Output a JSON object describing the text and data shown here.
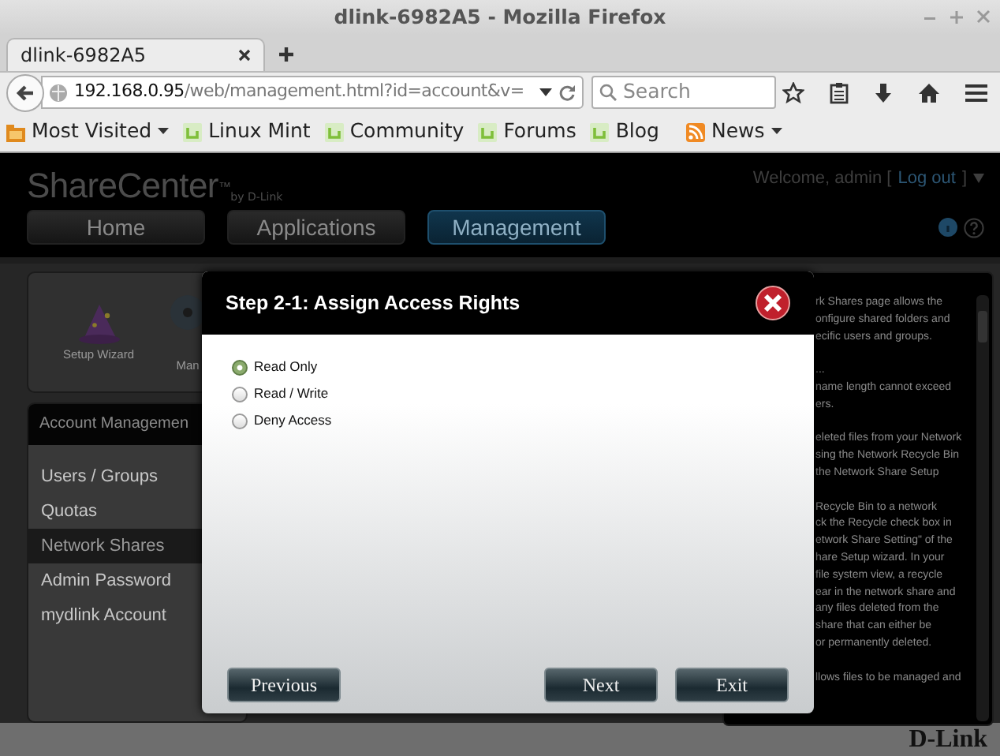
{
  "window": {
    "title": "dlink-6982A5 - Mozilla Firefox"
  },
  "tabs": [
    {
      "label": "dlink-6982A5",
      "selected": true
    }
  ],
  "address_bar": {
    "host": "192.168.0.95",
    "path": "/web/management.html?id=account&v="
  },
  "search": {
    "placeholder": "Search"
  },
  "bookmarks": [
    {
      "label": "Most Visited",
      "kind": "folder"
    },
    {
      "label": "Linux Mint",
      "kind": "link"
    },
    {
      "label": "Community",
      "kind": "link"
    },
    {
      "label": "Forums",
      "kind": "link"
    },
    {
      "label": "Blog",
      "kind": "link"
    },
    {
      "label": "News",
      "kind": "feed"
    }
  ],
  "header": {
    "logo": "ShareCenter",
    "logo_mark": "™",
    "logo_by": "by D-Link",
    "welcome": "Welcome, admin [",
    "logout": "Log out",
    "welcome_end": "]"
  },
  "nav": [
    {
      "label": "Home",
      "selected": false
    },
    {
      "label": "Applications",
      "selected": false
    },
    {
      "label": "Management",
      "selected": true
    }
  ],
  "shortcuts": [
    {
      "label": "Setup Wizard",
      "kind": "wizard"
    },
    {
      "label": "Man",
      "kind": "disc"
    }
  ],
  "sidebar": {
    "title": "Account Managemen",
    "items": [
      {
        "label": "Users / Groups",
        "selected": false
      },
      {
        "label": "Quotas",
        "selected": false
      },
      {
        "label": "Network Shares",
        "selected": true
      },
      {
        "label": "Admin Password",
        "selected": false
      },
      {
        "label": "mydlink Account",
        "selected": false
      }
    ]
  },
  "help": {
    "paragraphs": [
      [
        "rk Shares page allows the",
        "onfigure shared folders and",
        "ecific users and groups."
      ],
      [
        "...",
        "name length cannot exceed",
        "ers."
      ],
      [
        "eleted files from your Network",
        "sing the Network Recycle Bin",
        "the Network Share Setup"
      ],
      [
        "Recycle Bin to a network",
        "ck the Recycle check box in",
        "etwork Share Setting\" of the",
        "hare Setup wizard. In your",
        "file system view, a recycle",
        "ear in the network share and",
        "any files deleted from the",
        "share that can either be",
        "or permanently deleted."
      ],
      [
        "llows files to be managed and"
      ]
    ]
  },
  "dialog": {
    "title": "Step 2-1: Assign Access Rights",
    "options": [
      {
        "label": "Read Only",
        "selected": true
      },
      {
        "label": "Read / Write",
        "selected": false
      },
      {
        "label": "Deny Access",
        "selected": false
      }
    ],
    "buttons": [
      {
        "label": "Previous",
        "kind": "back"
      },
      {
        "label": "Next",
        "kind": "forward"
      },
      {
        "label": "Exit",
        "kind": "forward"
      }
    ]
  },
  "footer": {
    "logo": "D-Link"
  }
}
